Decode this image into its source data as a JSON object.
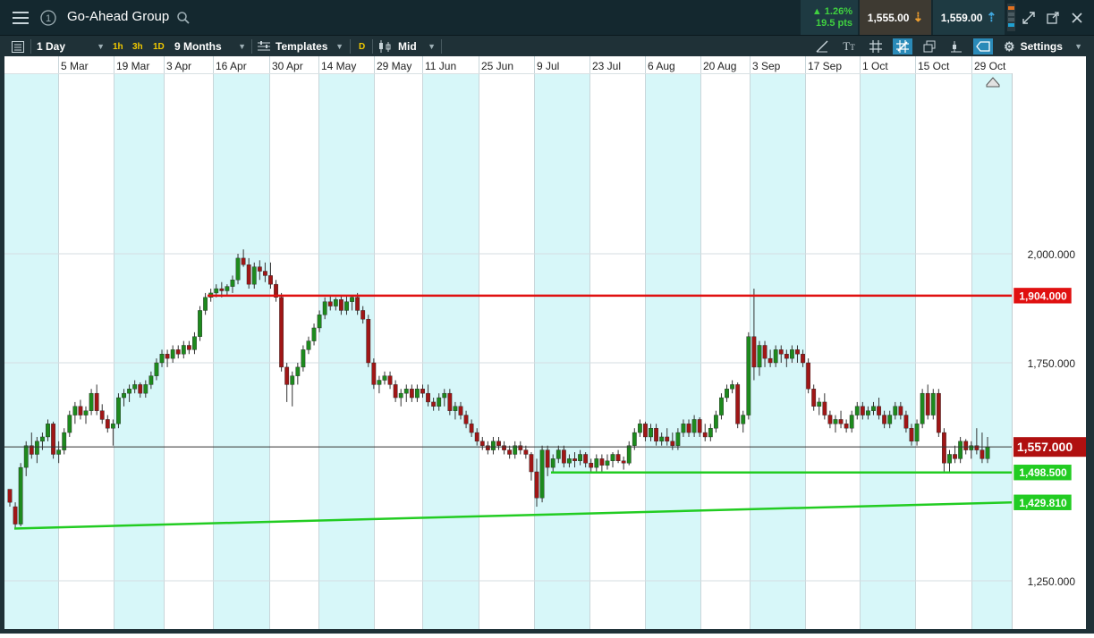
{
  "app": {
    "instrument": "Go-Ahead Group",
    "info_label": "1"
  },
  "quote": {
    "change_pct": "1.26%",
    "change_pts": "19.5 pts",
    "sell_price": "1,555.00",
    "buy_price": "1,559.00"
  },
  "toolbar": {
    "interval": "1 Day",
    "quick_intervals": [
      "1h",
      "3h",
      "1D"
    ],
    "range": "9 Months",
    "templates": "Templates",
    "d_badge": "D",
    "price_type": "Mid",
    "settings": "Settings"
  },
  "colors": {
    "background_dark": "#14282f",
    "toolbar_bg": "#1f3137",
    "up_candle": "#1d8a1d",
    "down_candle": "#a01616",
    "resistance_line": "#e01010",
    "support_line": "#22cc22",
    "band": "#d7f7f9",
    "current_price_tag": "#b01010"
  },
  "chart_data": {
    "type": "candlestick",
    "x_ticks": [
      "5 Mar",
      "19 Mar",
      "3 Apr",
      "16 Apr",
      "30 Apr",
      "14 May",
      "29 May",
      "11 Jun",
      "25 Jun",
      "9 Jul",
      "23 Jul",
      "6 Aug",
      "20 Aug",
      "3 Sep",
      "17 Sep",
      "1 Oct",
      "15 Oct",
      "29 Oct"
    ],
    "y_ticks": [
      "2,000.000",
      "1,750.000",
      "1,250.000"
    ],
    "y_tick_values": [
      2000,
      1750,
      1250
    ],
    "ylim": [
      1240,
      2125
    ],
    "price_lines": [
      {
        "label": "1,904.000",
        "value": 1904,
        "kind": "resistance"
      },
      {
        "label": "1,557.000",
        "value": 1557,
        "kind": "current"
      },
      {
        "label": "1,498.500",
        "value": 1498.5,
        "kind": "support"
      },
      {
        "label": "1,429.810",
        "value": 1429.81,
        "kind": "trendline"
      }
    ],
    "trendline": {
      "start_value": 1370,
      "end_value": 1429.81
    },
    "candles": [
      [
        1460,
        1460,
        1420,
        1430
      ],
      [
        1420,
        1430,
        1370,
        1380
      ],
      [
        1380,
        1520,
        1375,
        1510
      ],
      [
        1510,
        1570,
        1490,
        1560
      ],
      [
        1560,
        1590,
        1530,
        1540
      ],
      [
        1540,
        1580,
        1520,
        1570
      ],
      [
        1570,
        1590,
        1550,
        1580
      ],
      [
        1580,
        1620,
        1570,
        1610
      ],
      [
        1610,
        1615,
        1530,
        1540
      ],
      [
        1540,
        1570,
        1520,
        1550
      ],
      [
        1550,
        1600,
        1540,
        1590
      ],
      [
        1590,
        1640,
        1580,
        1630
      ],
      [
        1630,
        1660,
        1610,
        1650
      ],
      [
        1650,
        1665,
        1620,
        1630
      ],
      [
        1630,
        1650,
        1610,
        1640
      ],
      [
        1640,
        1690,
        1630,
        1680
      ],
      [
        1680,
        1700,
        1630,
        1640
      ],
      [
        1640,
        1655,
        1610,
        1620
      ],
      [
        1620,
        1630,
        1590,
        1600
      ],
      [
        1600,
        1620,
        1560,
        1610
      ],
      [
        1610,
        1680,
        1600,
        1670
      ],
      [
        1670,
        1690,
        1650,
        1680
      ],
      [
        1680,
        1700,
        1660,
        1690
      ],
      [
        1690,
        1710,
        1680,
        1700
      ],
      [
        1700,
        1705,
        1670,
        1680
      ],
      [
        1680,
        1710,
        1670,
        1700
      ],
      [
        1700,
        1730,
        1690,
        1720
      ],
      [
        1720,
        1760,
        1710,
        1750
      ],
      [
        1750,
        1780,
        1740,
        1770
      ],
      [
        1770,
        1780,
        1740,
        1760
      ],
      [
        1760,
        1790,
        1750,
        1780
      ],
      [
        1780,
        1790,
        1760,
        1770
      ],
      [
        1770,
        1800,
        1760,
        1790
      ],
      [
        1790,
        1800,
        1770,
        1780
      ],
      [
        1780,
        1820,
        1770,
        1810
      ],
      [
        1810,
        1880,
        1800,
        1870
      ],
      [
        1870,
        1910,
        1860,
        1900
      ],
      [
        1900,
        1920,
        1890,
        1910
      ],
      [
        1910,
        1930,
        1900,
        1920
      ],
      [
        1920,
        1935,
        1900,
        1915
      ],
      [
        1915,
        1930,
        1905,
        1925
      ],
      [
        1925,
        1950,
        1910,
        1940
      ],
      [
        1940,
        2000,
        1930,
        1990
      ],
      [
        1990,
        2010,
        1970,
        1975
      ],
      [
        1975,
        1990,
        1920,
        1930
      ],
      [
        1930,
        1980,
        1920,
        1970
      ],
      [
        1970,
        1985,
        1940,
        1960
      ],
      [
        1960,
        1980,
        1935,
        1950
      ],
      [
        1950,
        1980,
        1920,
        1930
      ],
      [
        1930,
        1940,
        1890,
        1900
      ],
      [
        1900,
        1910,
        1730,
        1740
      ],
      [
        1740,
        1750,
        1660,
        1700
      ],
      [
        1700,
        1730,
        1650,
        1720
      ],
      [
        1720,
        1750,
        1700,
        1740
      ],
      [
        1740,
        1790,
        1730,
        1780
      ],
      [
        1780,
        1810,
        1770,
        1800
      ],
      [
        1800,
        1840,
        1790,
        1830
      ],
      [
        1830,
        1870,
        1820,
        1860
      ],
      [
        1860,
        1900,
        1850,
        1890
      ],
      [
        1890,
        1905,
        1870,
        1880
      ],
      [
        1880,
        1900,
        1870,
        1895
      ],
      [
        1895,
        1905,
        1860,
        1870
      ],
      [
        1870,
        1905,
        1860,
        1890
      ],
      [
        1890,
        1905,
        1870,
        1900
      ],
      [
        1900,
        1910,
        1860,
        1870
      ],
      [
        1870,
        1880,
        1840,
        1850
      ],
      [
        1850,
        1860,
        1740,
        1750
      ],
      [
        1750,
        1760,
        1690,
        1700
      ],
      [
        1700,
        1720,
        1680,
        1710
      ],
      [
        1710,
        1730,
        1700,
        1720
      ],
      [
        1720,
        1730,
        1690,
        1700
      ],
      [
        1700,
        1710,
        1660,
        1670
      ],
      [
        1670,
        1690,
        1650,
        1680
      ],
      [
        1680,
        1700,
        1660,
        1690
      ],
      [
        1690,
        1700,
        1660,
        1670
      ],
      [
        1670,
        1700,
        1660,
        1690
      ],
      [
        1690,
        1700,
        1670,
        1680
      ],
      [
        1680,
        1700,
        1650,
        1660
      ],
      [
        1660,
        1670,
        1640,
        1650
      ],
      [
        1650,
        1680,
        1640,
        1670
      ],
      [
        1670,
        1690,
        1650,
        1680
      ],
      [
        1680,
        1690,
        1630,
        1640
      ],
      [
        1640,
        1660,
        1620,
        1650
      ],
      [
        1650,
        1660,
        1620,
        1630
      ],
      [
        1630,
        1640,
        1600,
        1610
      ],
      [
        1610,
        1620,
        1580,
        1590
      ],
      [
        1590,
        1600,
        1560,
        1570
      ],
      [
        1570,
        1580,
        1550,
        1560
      ],
      [
        1560,
        1570,
        1540,
        1550
      ],
      [
        1550,
        1580,
        1540,
        1570
      ],
      [
        1570,
        1580,
        1550,
        1560
      ],
      [
        1560,
        1570,
        1540,
        1550
      ],
      [
        1550,
        1560,
        1530,
        1540
      ],
      [
        1540,
        1570,
        1530,
        1560
      ],
      [
        1560,
        1570,
        1540,
        1550
      ],
      [
        1550,
        1560,
        1530,
        1540
      ],
      [
        1540,
        1545,
        1480,
        1500
      ],
      [
        1500,
        1530,
        1420,
        1440
      ],
      [
        1440,
        1560,
        1430,
        1550
      ],
      [
        1550,
        1560,
        1490,
        1510
      ],
      [
        1510,
        1540,
        1500,
        1530
      ],
      [
        1530,
        1560,
        1520,
        1550
      ],
      [
        1550,
        1560,
        1510,
        1520
      ],
      [
        1520,
        1540,
        1510,
        1530
      ],
      [
        1530,
        1545,
        1510,
        1525
      ],
      [
        1525,
        1550,
        1515,
        1540
      ],
      [
        1540,
        1545,
        1510,
        1520
      ],
      [
        1520,
        1530,
        1500,
        1510
      ],
      [
        1510,
        1540,
        1500,
        1530
      ],
      [
        1530,
        1540,
        1500,
        1515
      ],
      [
        1515,
        1540,
        1505,
        1525
      ],
      [
        1525,
        1545,
        1510,
        1540
      ],
      [
        1540,
        1550,
        1520,
        1525
      ],
      [
        1525,
        1535,
        1505,
        1520
      ],
      [
        1520,
        1570,
        1515,
        1560
      ],
      [
        1560,
        1600,
        1550,
        1590
      ],
      [
        1590,
        1620,
        1580,
        1610
      ],
      [
        1610,
        1615,
        1570,
        1580
      ],
      [
        1580,
        1610,
        1570,
        1600
      ],
      [
        1600,
        1610,
        1560,
        1570
      ],
      [
        1570,
        1590,
        1560,
        1580
      ],
      [
        1580,
        1600,
        1560,
        1570
      ],
      [
        1570,
        1590,
        1550,
        1560
      ],
      [
        1560,
        1600,
        1550,
        1590
      ],
      [
        1590,
        1620,
        1580,
        1610
      ],
      [
        1610,
        1620,
        1580,
        1590
      ],
      [
        1590,
        1630,
        1580,
        1620
      ],
      [
        1620,
        1625,
        1580,
        1590
      ],
      [
        1590,
        1610,
        1570,
        1580
      ],
      [
        1580,
        1610,
        1570,
        1600
      ],
      [
        1600,
        1640,
        1590,
        1630
      ],
      [
        1630,
        1680,
        1620,
        1670
      ],
      [
        1670,
        1700,
        1660,
        1690
      ],
      [
        1690,
        1710,
        1680,
        1700
      ],
      [
        1700,
        1705,
        1600,
        1610
      ],
      [
        1610,
        1640,
        1590,
        1630
      ],
      [
        1630,
        1820,
        1620,
        1810
      ],
      [
        1810,
        1920,
        1710,
        1740
      ],
      [
        1740,
        1800,
        1720,
        1790
      ],
      [
        1790,
        1800,
        1740,
        1760
      ],
      [
        1760,
        1780,
        1740,
        1750
      ],
      [
        1750,
        1790,
        1740,
        1780
      ],
      [
        1780,
        1790,
        1750,
        1770
      ],
      [
        1770,
        1780,
        1740,
        1760
      ],
      [
        1760,
        1790,
        1750,
        1780
      ],
      [
        1780,
        1790,
        1750,
        1770
      ],
      [
        1770,
        1780,
        1740,
        1750
      ],
      [
        1750,
        1760,
        1680,
        1690
      ],
      [
        1690,
        1700,
        1640,
        1650
      ],
      [
        1650,
        1670,
        1630,
        1660
      ],
      [
        1660,
        1680,
        1620,
        1630
      ],
      [
        1630,
        1640,
        1600,
        1610
      ],
      [
        1610,
        1630,
        1590,
        1620
      ],
      [
        1620,
        1640,
        1600,
        1610
      ],
      [
        1610,
        1620,
        1590,
        1600
      ],
      [
        1600,
        1640,
        1590,
        1630
      ],
      [
        1630,
        1660,
        1620,
        1650
      ],
      [
        1650,
        1660,
        1620,
        1630
      ],
      [
        1630,
        1650,
        1620,
        1640
      ],
      [
        1640,
        1660,
        1630,
        1650
      ],
      [
        1650,
        1670,
        1620,
        1630
      ],
      [
        1630,
        1640,
        1600,
        1610
      ],
      [
        1610,
        1640,
        1600,
        1630
      ],
      [
        1630,
        1660,
        1620,
        1650
      ],
      [
        1650,
        1660,
        1620,
        1630
      ],
      [
        1630,
        1640,
        1590,
        1600
      ],
      [
        1600,
        1610,
        1560,
        1570
      ],
      [
        1570,
        1620,
        1560,
        1610
      ],
      [
        1610,
        1690,
        1600,
        1680
      ],
      [
        1680,
        1700,
        1620,
        1630
      ],
      [
        1630,
        1690,
        1620,
        1680
      ],
      [
        1680,
        1690,
        1580,
        1590
      ],
      [
        1590,
        1600,
        1500,
        1520
      ],
      [
        1520,
        1550,
        1500,
        1540
      ],
      [
        1540,
        1560,
        1520,
        1530
      ],
      [
        1530,
        1580,
        1520,
        1570
      ],
      [
        1570,
        1575,
        1540,
        1550
      ],
      [
        1550,
        1570,
        1530,
        1560
      ],
      [
        1560,
        1600,
        1540,
        1550
      ],
      [
        1550,
        1590,
        1520,
        1530
      ],
      [
        1530,
        1580,
        1520,
        1557
      ]
    ]
  }
}
